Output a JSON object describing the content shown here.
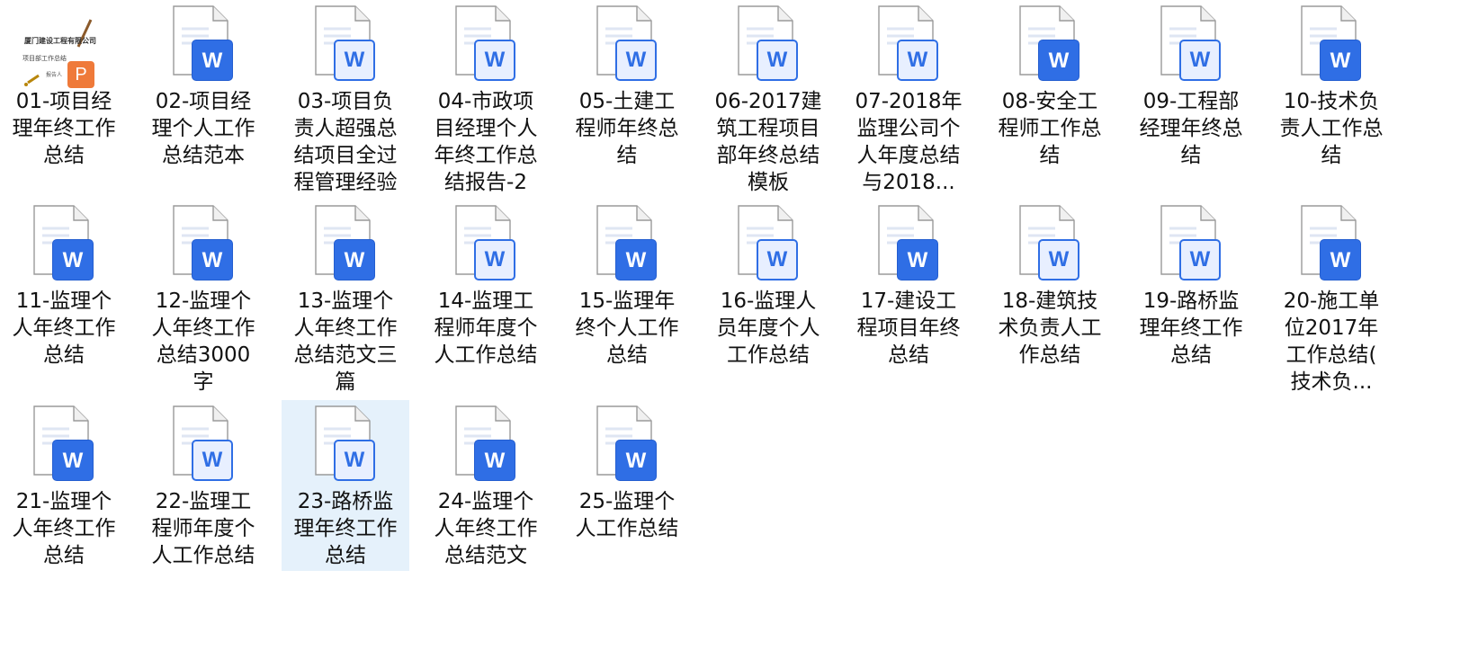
{
  "files": [
    {
      "label": "01-项目经\n理年终工作\n总结",
      "type": "ppt",
      "thumb_title": "厦门建设工程有限公司",
      "thumb_sub": "项目部工作总结",
      "thumb_by": "报告人"
    },
    {
      "label": "02-项目经\n理个人工作\n总结范本",
      "type": "word",
      "style": "solid"
    },
    {
      "label": "03-项目负\n责人超强总\n结项目全过\n程管理经验",
      "type": "word",
      "style": "light"
    },
    {
      "label": "04-市政项\n目经理个人\n年终工作总\n结报告-2",
      "type": "word",
      "style": "light"
    },
    {
      "label": "05-土建工\n程师年终总\n结",
      "type": "word",
      "style": "light"
    },
    {
      "label": "06-2017建\n筑工程项目\n部年终总结\n模板",
      "type": "word",
      "style": "light"
    },
    {
      "label": "07-2018年\n监理公司个\n人年度总结\n与2018...",
      "type": "word",
      "style": "light"
    },
    {
      "label": "08-安全工\n程师工作总\n结",
      "type": "word",
      "style": "solid"
    },
    {
      "label": "09-工程部\n经理年终总\n结",
      "type": "word",
      "style": "light"
    },
    {
      "label": "10-技术负\n责人工作总\n结",
      "type": "word",
      "style": "solid"
    },
    {
      "label": "11-监理个\n人年终工作\n总结",
      "type": "word",
      "style": "solid"
    },
    {
      "label": "12-监理个\n人年终工作\n总结3000\n字",
      "type": "word",
      "style": "solid"
    },
    {
      "label": "13-监理个\n人年终工作\n总结范文三\n篇",
      "type": "word",
      "style": "solid"
    },
    {
      "label": "14-监理工\n程师年度个\n人工作总结",
      "type": "word",
      "style": "light"
    },
    {
      "label": "15-监理年\n终个人工作\n总结",
      "type": "word",
      "style": "solid"
    },
    {
      "label": "16-监理人\n员年度个人\n工作总结",
      "type": "word",
      "style": "light"
    },
    {
      "label": "17-建设工\n程项目年终\n总结",
      "type": "word",
      "style": "solid"
    },
    {
      "label": "18-建筑技\n术负责人工\n作总结",
      "type": "word",
      "style": "light"
    },
    {
      "label": "19-路桥监\n理年终工作\n总结",
      "type": "word",
      "style": "light"
    },
    {
      "label": "20-施工单\n位2017年\n工作总结(\n技术负...",
      "type": "word",
      "style": "solid"
    },
    {
      "label": "21-监理个\n人年终工作\n总结",
      "type": "word",
      "style": "solid"
    },
    {
      "label": "22-监理工\n程师年度个\n人工作总结",
      "type": "word",
      "style": "light"
    },
    {
      "label": "23-路桥监\n理年终工作\n总结",
      "type": "word",
      "style": "light",
      "selected": true
    },
    {
      "label": "24-监理个\n人年终工作\n总结范文",
      "type": "word",
      "style": "solid"
    },
    {
      "label": "25-监理个\n人工作总结",
      "type": "word",
      "style": "solid"
    }
  ],
  "word_badge_letter": "W",
  "ppt_badge_letter": "P",
  "colors": {
    "word_blue": "#2f6ee5",
    "ppt_orange": "#ef7a3a",
    "selection": "#e5f1fb"
  }
}
